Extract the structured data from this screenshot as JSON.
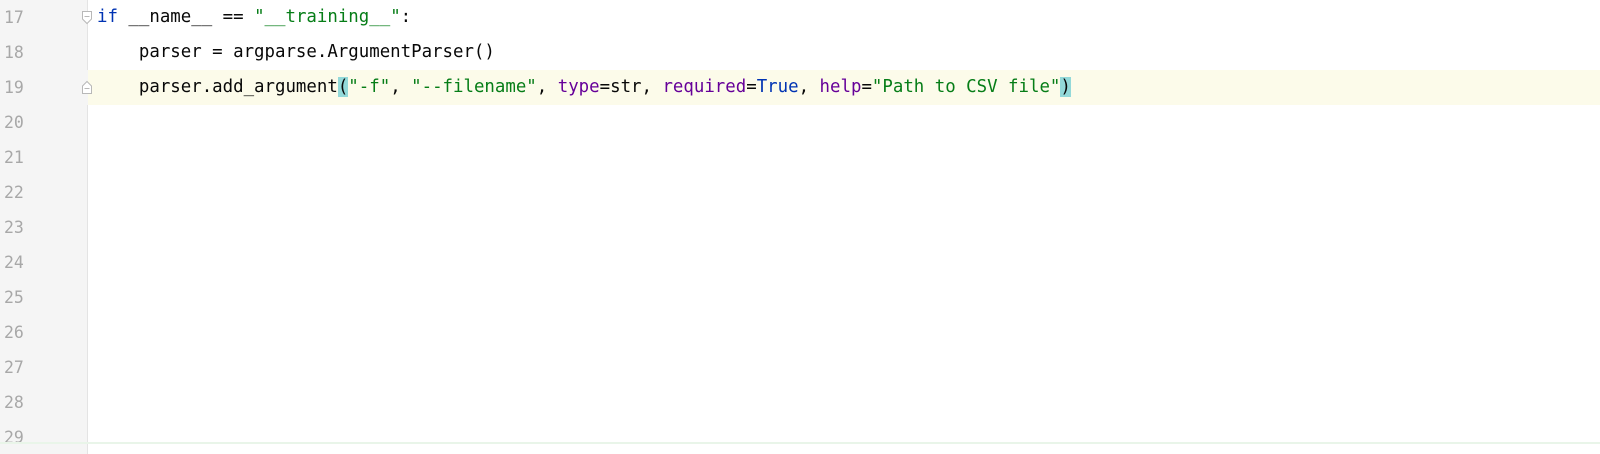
{
  "editor": {
    "lines": [
      {
        "number": "17",
        "tokens": [
          "if",
          " __name__ == ",
          "\"__training__\"",
          ":"
        ]
      },
      {
        "number": "18",
        "tokens": [
          "    parser = argparse.ArgumentParser()"
        ]
      },
      {
        "number": "19",
        "tokens": [
          "    parser.add_argument",
          "(",
          "\"-f\"",
          ", ",
          "\"--filename\"",
          ", ",
          "type",
          "=str, ",
          "required",
          "=",
          "True",
          ", ",
          "help",
          "=",
          "\"Path to CSV file\"",
          ")"
        ]
      },
      {
        "number": "20"
      },
      {
        "number": "21"
      },
      {
        "number": "22"
      },
      {
        "number": "23"
      },
      {
        "number": "24"
      },
      {
        "number": "25"
      },
      {
        "number": "26"
      },
      {
        "number": "27"
      },
      {
        "number": "28"
      },
      {
        "number": "29"
      }
    ],
    "colors": {
      "keyword": "#0033b3",
      "string": "#067d17",
      "kwarg": "#660099",
      "brace_highlight": "#93d9d9",
      "current_line": "#fcfbea",
      "gutter_bg": "#f5f5f5",
      "line_number": "#a8a8a8"
    },
    "icons": {
      "line17": "fold-open-icon",
      "line19": "fold-end-icon"
    }
  }
}
